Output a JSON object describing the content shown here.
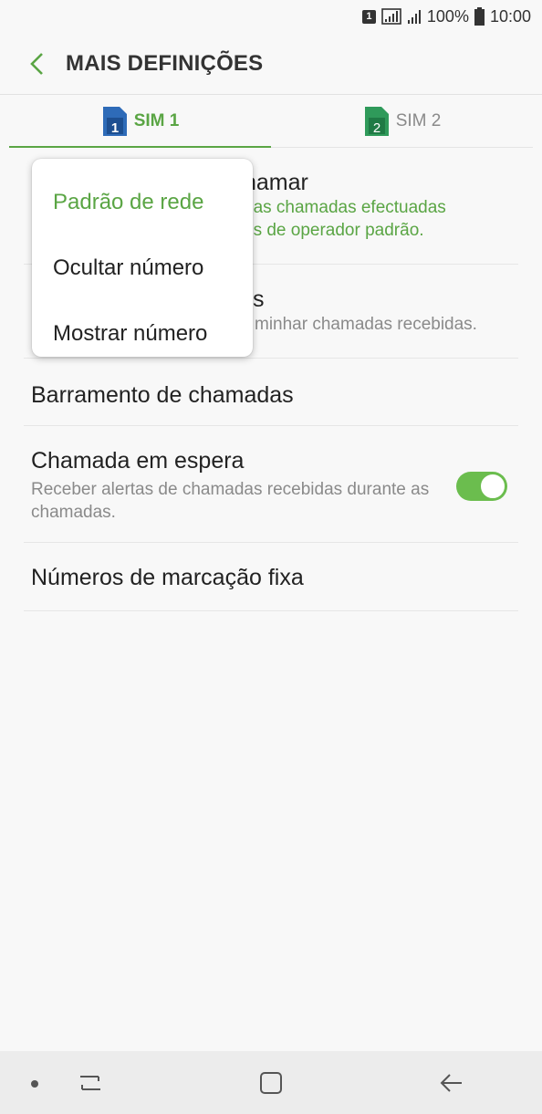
{
  "status_bar": {
    "sim_indicator": "1",
    "battery": "100%",
    "time": "10:00",
    "icons": [
      "sim-badge-icon",
      "signal-icon",
      "signal-small-icon",
      "battery-icon"
    ]
  },
  "app_bar": {
    "back_icon": "back-arrow-icon",
    "title": "MAIS DEFINIÇÕES"
  },
  "tabs": [
    {
      "label": "SIM 1",
      "sim_number": "1",
      "color": "#2e6bb8",
      "active": true
    },
    {
      "label": "SIM 2",
      "sim_number": "2",
      "color": "#2f9a5a",
      "active": false
    }
  ],
  "settings": {
    "row1": {
      "title_visible": "hamar",
      "subtitle_visible": "nas chamadas efectuadas\nes de operador padrão."
    },
    "row2": {
      "title_visible": "s",
      "subtitle_visible": "minhar chamadas recebidas."
    },
    "row3": {
      "title": "Barramento de chamadas"
    },
    "row4": {
      "title": "Chamada em espera",
      "subtitle": "Receber alertas de chamadas recebidas durante as chamadas.",
      "toggle_on": true
    },
    "row5": {
      "title": "Números de marcação fixa"
    }
  },
  "popup": {
    "options": [
      {
        "label": "Padrão de rede",
        "selected": true
      },
      {
        "label": "Ocultar número",
        "selected": false
      },
      {
        "label": "Mostrar número",
        "selected": false
      }
    ]
  },
  "nav_bar": {
    "icons": [
      "recent-apps-icon",
      "home-icon",
      "back-icon"
    ]
  },
  "colors": {
    "accent": "#5aa544",
    "toggle_on": "#6bbd4e",
    "background": "#f8f8f8"
  }
}
